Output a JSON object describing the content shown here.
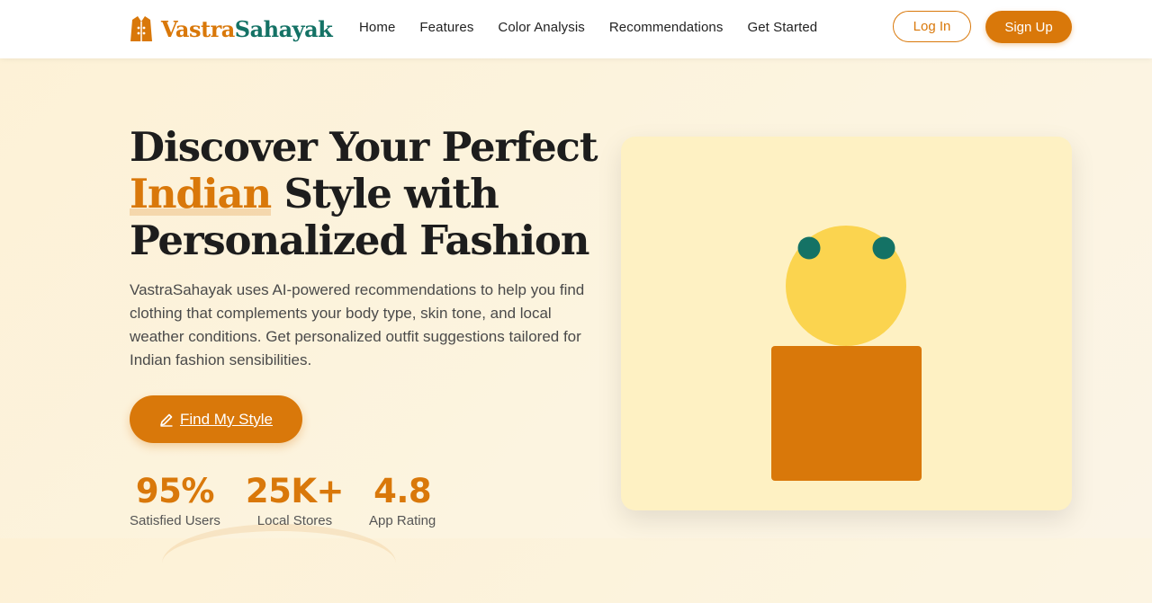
{
  "brand": {
    "part1": "Vastra",
    "part2": "Sahayak",
    "icon": "vest-icon",
    "colors": {
      "primary": "#d9780a",
      "secondary": "#147265"
    }
  },
  "nav": {
    "items": [
      {
        "label": "Home"
      },
      {
        "label": "Features"
      },
      {
        "label": "Color Analysis"
      },
      {
        "label": "Recommendations"
      },
      {
        "label": "Get Started"
      }
    ],
    "login_label": "Log In",
    "signup_label": "Sign Up"
  },
  "hero": {
    "title_line1": "Discover Your Perfect",
    "title_highlight": "Indian",
    "title_line2_rest": " Style with",
    "title_line3": "Personalized Fashion",
    "description": "VastraSahayak uses AI-powered recommendations to help you find clothing that complements your body type, skin tone, and local weather conditions. Get personalized outfit suggestions tailored for Indian fashion sensibilities.",
    "cta_label": "Find My Style",
    "cta_icon": "pencil-icon"
  },
  "stats": [
    {
      "value": "95%",
      "label": "Satisfied Users"
    },
    {
      "value": "25K+",
      "label": "Local Stores"
    },
    {
      "value": "4.8",
      "label": "App Rating"
    }
  ],
  "illustration": {
    "colors": {
      "card": "#fef1c3",
      "head": "#fbd44f",
      "eyes": "#147265",
      "body": "#d9780a"
    }
  }
}
